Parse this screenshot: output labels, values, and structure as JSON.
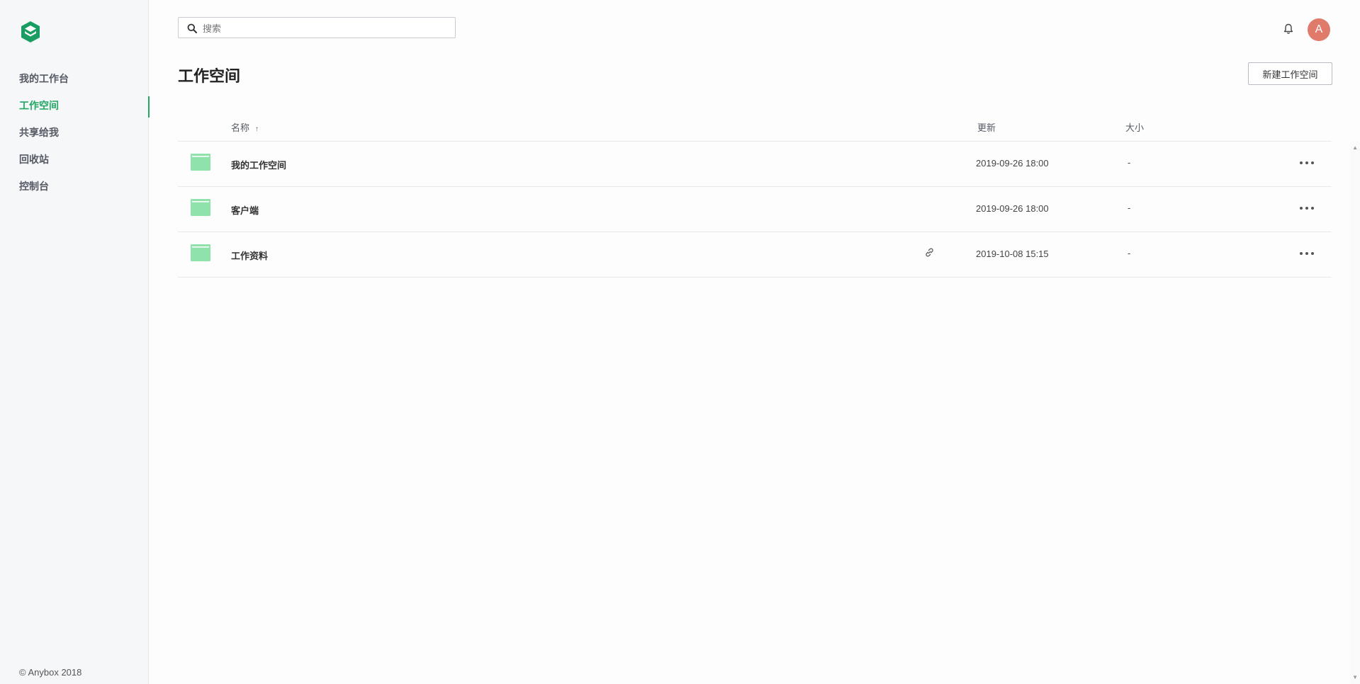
{
  "sidebar": {
    "items": [
      {
        "label": "我的工作台",
        "active": false
      },
      {
        "label": "工作空间",
        "active": true
      },
      {
        "label": "共享给我",
        "active": false
      },
      {
        "label": "回收站",
        "active": false
      },
      {
        "label": "控制台",
        "active": false
      }
    ],
    "copyright": "© Anybox 2018"
  },
  "header": {
    "search_placeholder": "搜索",
    "avatar_initial": "A"
  },
  "page": {
    "title": "工作空间",
    "new_button_label": "新建工作空间"
  },
  "table": {
    "columns": {
      "name": "名称",
      "sort_indicator": "↑",
      "updated": "更新",
      "size": "大小"
    },
    "rows": [
      {
        "name": "我的工作空间",
        "updated": "2019-09-26 18:00",
        "size": "-",
        "shared_link": false
      },
      {
        "name": "客户端",
        "updated": "2019-09-26 18:00",
        "size": "-",
        "shared_link": false
      },
      {
        "name": "工作资料",
        "updated": "2019-10-08 15:15",
        "size": "-",
        "shared_link": true
      }
    ]
  },
  "colors": {
    "accent": "#21a862",
    "folder": "#8fe3aa",
    "avatar": "#e07a6a"
  }
}
